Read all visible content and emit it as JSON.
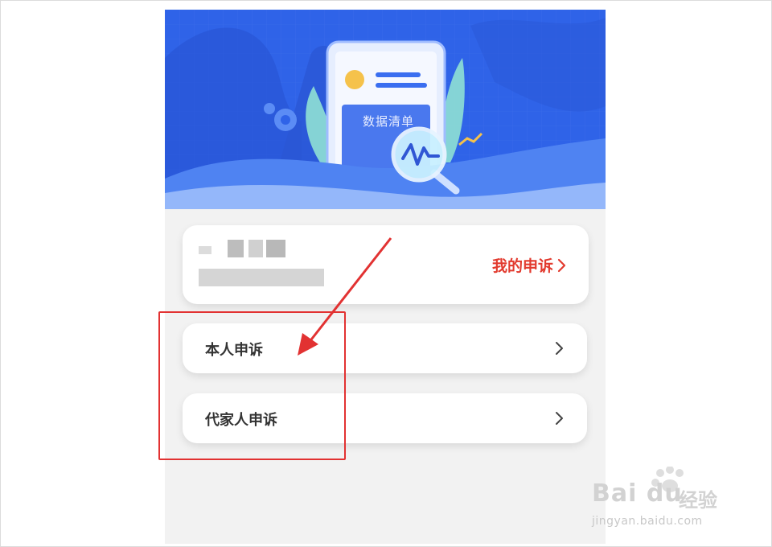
{
  "banner": {
    "label": "数据清单"
  },
  "user_card": {
    "my_appeal_label": "我的申诉"
  },
  "menu": {
    "items": [
      {
        "label": "本人申诉"
      },
      {
        "label": "代家人申诉"
      }
    ]
  },
  "watermark": {
    "brand": "Bai du",
    "brand_suffix": "经验",
    "url": "jingyan.baidu.com"
  },
  "colors": {
    "banner_blue": "#2f63e8",
    "accent_red": "#e23a2e",
    "annotation_red": "#e23232",
    "page_bg": "#f2f2f2"
  },
  "icons": {
    "chevron": "chevron-right-icon",
    "magnifier": "magnifier-chart-icon",
    "gear": "gear-icon"
  }
}
